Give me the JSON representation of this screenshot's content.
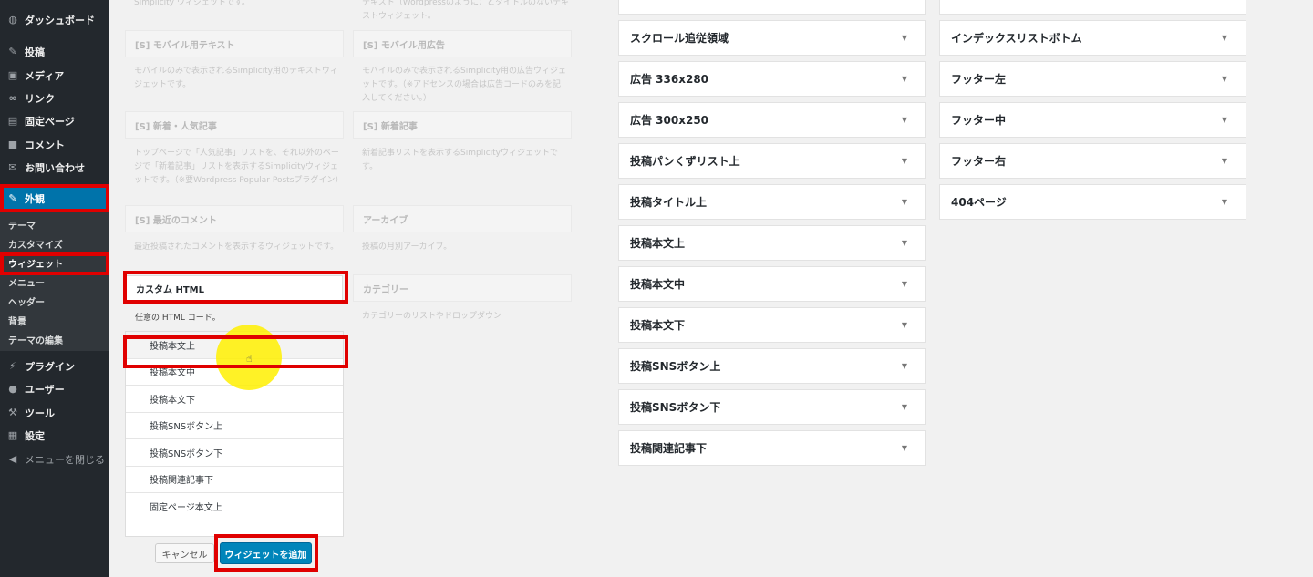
{
  "sidebar": {
    "items": [
      {
        "label": "ダッシュボード",
        "icon": "dashboard-icon",
        "glyph": "◍"
      },
      {
        "label": "投稿",
        "icon": "pin-icon",
        "glyph": "✎"
      },
      {
        "label": "メディア",
        "icon": "media-icon",
        "glyph": "▣"
      },
      {
        "label": "リンク",
        "icon": "link-icon",
        "glyph": "∞"
      },
      {
        "label": "固定ページ",
        "icon": "page-icon",
        "glyph": "▤"
      },
      {
        "label": "コメント",
        "icon": "comment-icon",
        "glyph": "■"
      },
      {
        "label": "お問い合わせ",
        "icon": "mail-icon",
        "glyph": "✉"
      },
      {
        "label": "外観",
        "icon": "appearance-icon",
        "glyph": "✎"
      },
      {
        "label": "プラグイン",
        "icon": "plugin-icon",
        "glyph": "⚡"
      },
      {
        "label": "ユーザー",
        "icon": "user-icon",
        "glyph": "●"
      },
      {
        "label": "ツール",
        "icon": "tool-icon",
        "glyph": "⚒"
      },
      {
        "label": "設定",
        "icon": "settings-icon",
        "glyph": "▦"
      },
      {
        "label": "メニューを閉じる",
        "icon": "collapse-icon",
        "glyph": "◀"
      }
    ],
    "submenu": [
      "テーマ",
      "カスタマイズ",
      "ウィジェット",
      "メニュー",
      "ヘッダー",
      "背景",
      "テーマの編集"
    ]
  },
  "available_widgets": {
    "top_desc_left": "Simplicity ウィジェットです。",
    "top_desc_right": "テキスト（Wordpressのように）とタイトルのないテキストウィジェット。",
    "widgets": [
      {
        "title": "[S] モバイル用テキスト",
        "desc": "モバイルのみで表示されるSimplicity用のテキストウィジェットです。"
      },
      {
        "title": "[S] モバイル用広告",
        "desc": "モバイルのみで表示されるSimplicity用の広告ウィジェットです。（※アドセンスの場合は広告コードのみを記入してください。）"
      },
      {
        "title": "[S] 新着・人気記事",
        "desc": "トップページで「人気記事」リストを、それ以外のページで「新着記事」リストを表示するSimplicityウィジェットです。（※要Wordpress Popular Postsプラグイン）"
      },
      {
        "title": "[S] 新着記事",
        "desc": "新着記事リストを表示するSimplicityウィジェットです。"
      },
      {
        "title": "[S] 最近のコメント",
        "desc": "最近投稿されたコメントを表示するウィジェットです。"
      },
      {
        "title": "アーカイブ",
        "desc": "投稿の月別アーカイブ。"
      },
      {
        "title": "カテゴリー",
        "desc": "カテゴリーのリストやドロップダウン"
      }
    ],
    "selected": {
      "title": "カスタム HTML",
      "desc": "任意の HTML コード。",
      "areas": [
        "投稿本文上",
        "投稿本文中",
        "投稿本文下",
        "投稿SNSボタン上",
        "投稿SNSボタン下",
        "投稿関連記事下",
        "固定ページ本文上"
      ],
      "cancel_label": "キャンセル",
      "add_label": "ウィジェットを追加"
    }
  },
  "widget_areas": {
    "left": [
      "スクロール追従領域",
      "広告 336x280",
      "広告 300x250",
      "投稿パンくずリスト上",
      "投稿タイトル上",
      "投稿本文上",
      "投稿本文中",
      "投稿本文下",
      "投稿SNSボタン上",
      "投稿SNSボタン下",
      "投稿関連記事下"
    ],
    "right": [
      "インデックスリストボトム",
      "フッター左",
      "フッター中",
      "フッター右",
      "404ページ"
    ],
    "arrow": "▼"
  },
  "colors": {
    "highlight": "#e00000",
    "accent": "#0073aa",
    "cursor": "#fff000"
  }
}
